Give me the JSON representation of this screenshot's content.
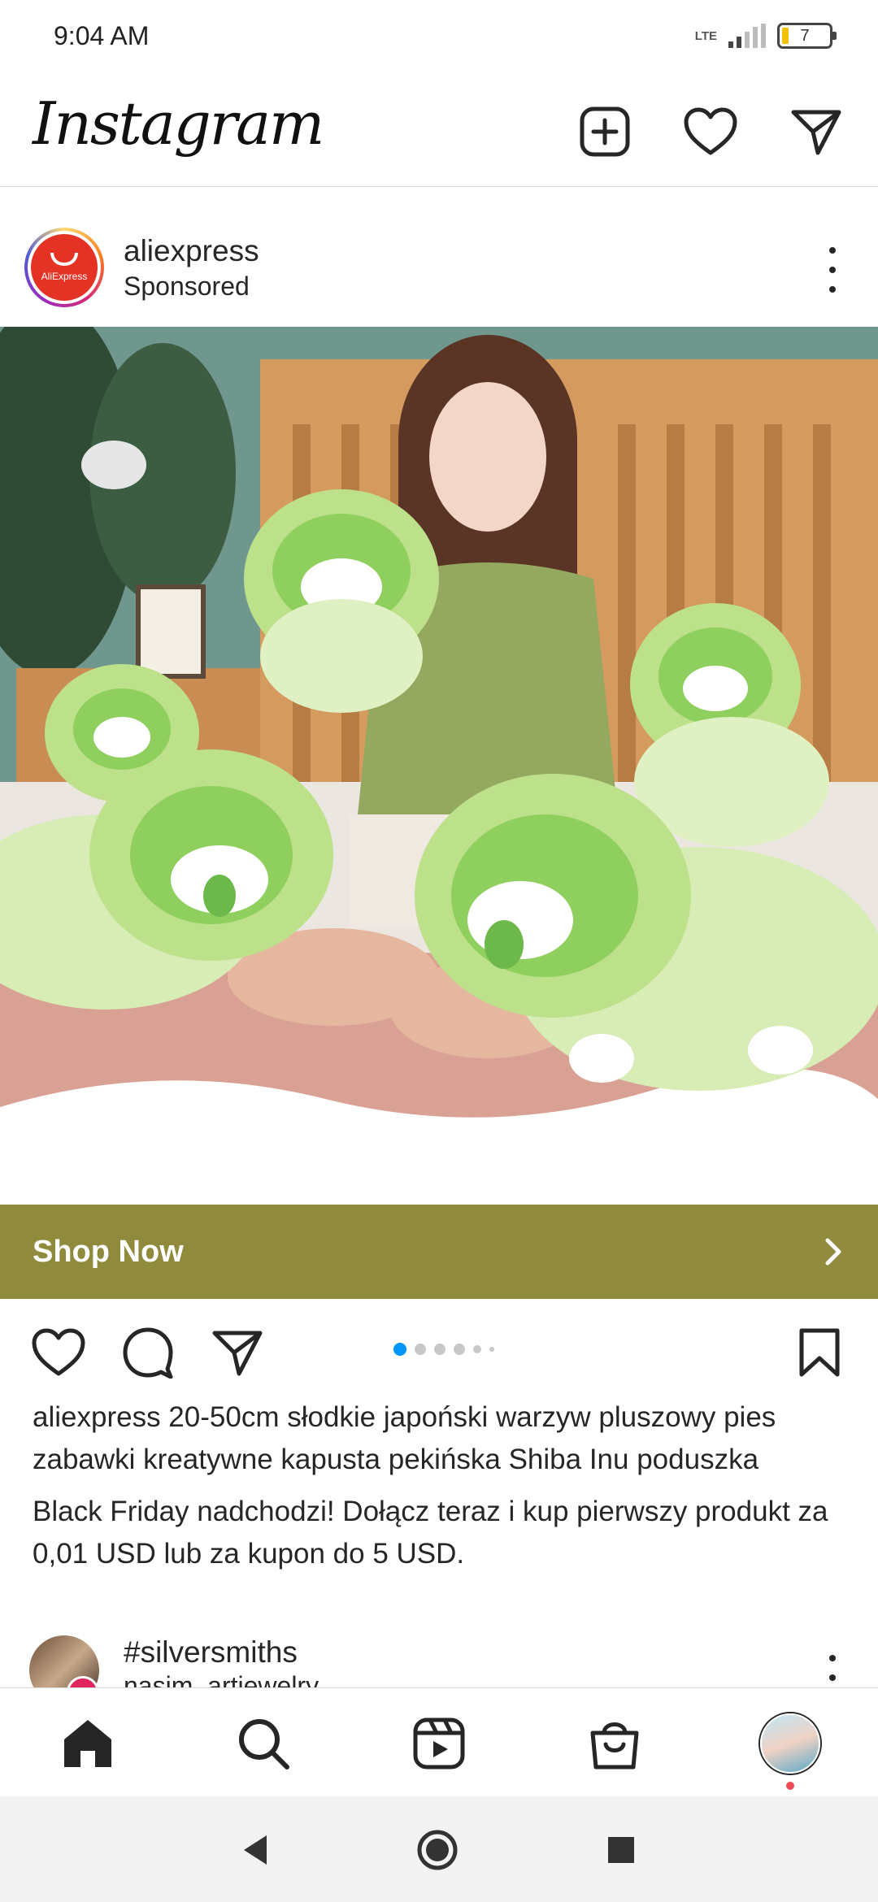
{
  "status_bar": {
    "time": "9:04 AM",
    "network": "LTE",
    "battery": "7",
    "battery_level_percent": 7
  },
  "header": {
    "app_title": "Instagram",
    "icons": [
      "new-post-icon",
      "heart-icon",
      "direct-message-icon"
    ]
  },
  "post": {
    "username": "aliexpress",
    "subtitle": "Sponsored",
    "avatar_label": "AliExpress",
    "cta_label": "Shop Now",
    "carousel": {
      "total": 6,
      "active_index": 0
    },
    "caption_username": "aliexpress",
    "caption_text": " 20-50cm słodkie japoński warzyw pluszowy pies zabawki kreatywne kapusta pekińska Shiba Inu poduszka",
    "caption_text_2": "Black Friday nadchodzi! Dołącz teraz i kup pierwszy produkt za 0,01 USD lub za kupon do 5 USD."
  },
  "next_post": {
    "username": "#silversmiths",
    "subtitle": "nasim_artjewelry"
  },
  "bottom_nav": {
    "items": [
      "home-icon",
      "search-icon",
      "reels-icon",
      "shop-icon",
      "profile-avatar"
    ]
  },
  "colors": {
    "cta_bar": "#8f8a3c",
    "accent_blue": "#0095f6",
    "notification_red": "#ed4956"
  }
}
